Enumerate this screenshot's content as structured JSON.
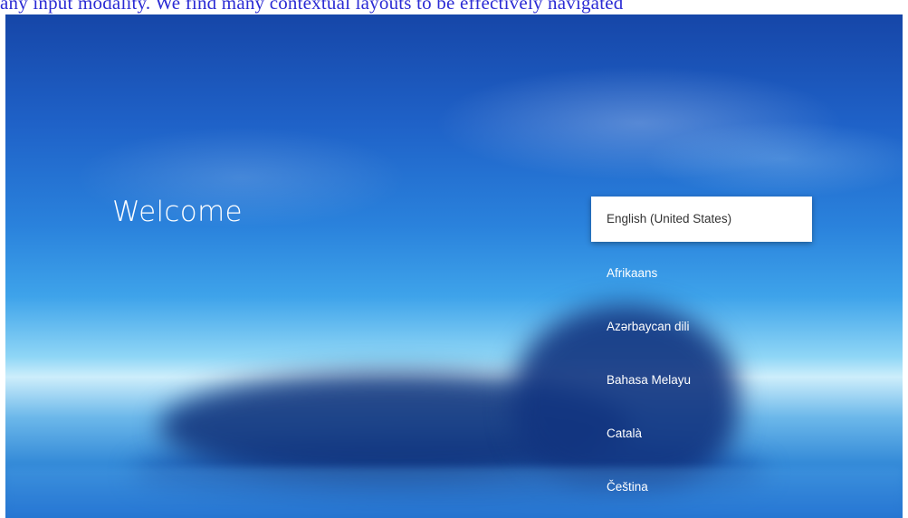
{
  "caption": "any input modality. We find many contextual layouts to be effectively navigated",
  "screen": {
    "welcome_title": "Welcome",
    "languages": [
      {
        "label": "English (United States)",
        "selected": true
      },
      {
        "label": "Afrikaans",
        "selected": false
      },
      {
        "label": "Azərbaycan dili",
        "selected": false
      },
      {
        "label": "Bahasa Melayu",
        "selected": false
      },
      {
        "label": "Català",
        "selected": false
      },
      {
        "label": "Čeština",
        "selected": false
      }
    ]
  },
  "colors": {
    "sky_top": "#1646a8",
    "horizon": "#cdeefb",
    "caption_text": "#2b2bd4",
    "selected_bg": "#ffffff"
  }
}
